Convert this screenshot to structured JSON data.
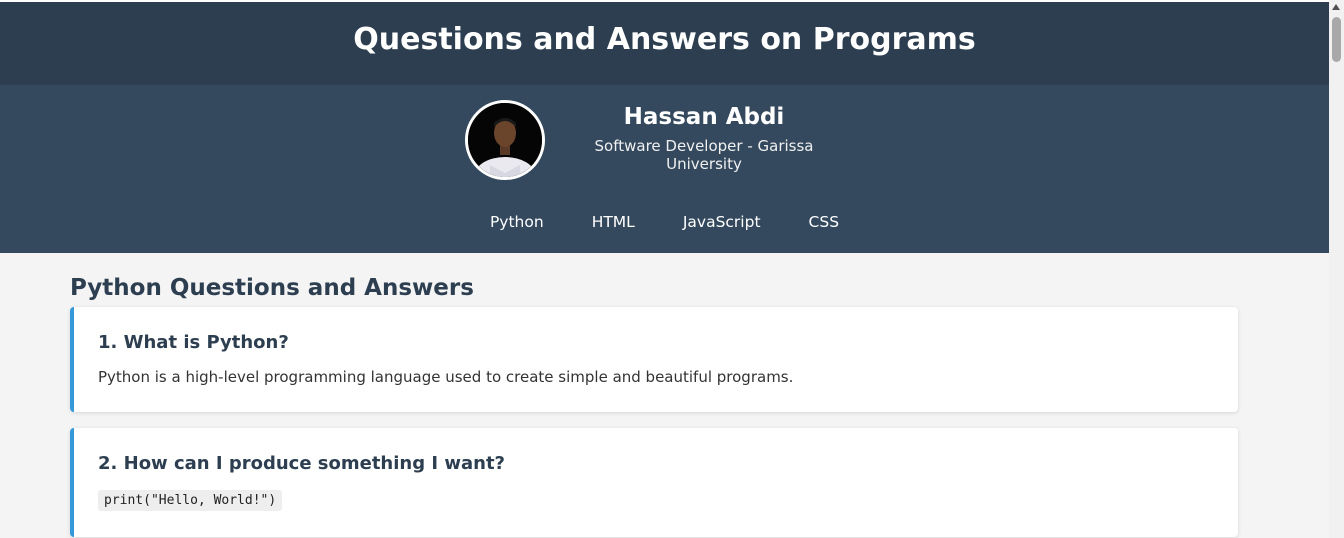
{
  "header": {
    "title": "Questions and Answers on Programs"
  },
  "profile": {
    "name": "Hassan Abdi",
    "role": "Software Developer - Garissa University",
    "avatar_icon": "profile-photo"
  },
  "nav": {
    "items": [
      {
        "label": "Python"
      },
      {
        "label": "HTML"
      },
      {
        "label": "JavaScript"
      },
      {
        "label": "CSS"
      }
    ]
  },
  "section": {
    "title": "Python Questions and Answers",
    "cards": [
      {
        "question": "1. What is Python?",
        "answer": "Python is a high-level programming language used to create simple and beautiful programs."
      },
      {
        "question": "2. How can I produce something I want?",
        "code": "print(\"Hello, World!\")"
      }
    ]
  },
  "colors": {
    "header_bg": "#2c3e50",
    "band_bg": "#34495e",
    "accent": "#3498db",
    "page_bg": "#f4f4f4"
  }
}
